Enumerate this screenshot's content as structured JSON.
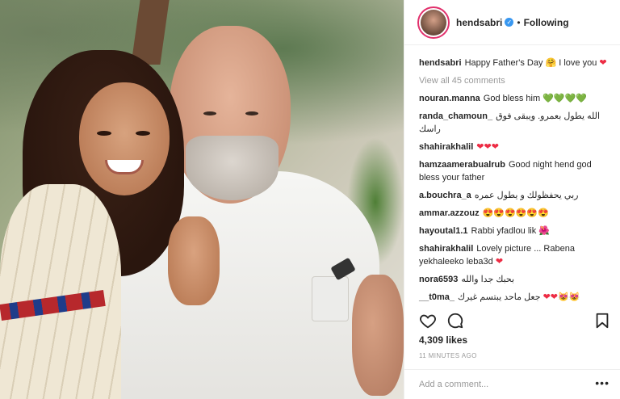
{
  "photo": {
    "description_hidden": ""
  },
  "header": {
    "username": "hendsabri",
    "separator": "•",
    "follow_status": "Following"
  },
  "caption": {
    "username": "hendsabri",
    "text": "Happy Father's Day 🤗 I love you",
    "heart": "❤"
  },
  "view_all": "View all 45 comments",
  "comments": [
    {
      "user": "nouran.manna",
      "text": "God bless him",
      "emoji": "💚💚💚💚"
    },
    {
      "user": "randa_chamoun_",
      "text": "الله يطول بعمرو. ويبقى فوق راسك",
      "emoji": ""
    },
    {
      "user": "shahirakhalil",
      "text": "",
      "emoji": "❤❤❤"
    },
    {
      "user": "hamzaamerabualrub",
      "text": "Good night hend god bless your father",
      "emoji": ""
    },
    {
      "user": "a.bouchra_a",
      "text": "ربي يحفظولك و يطول عمره",
      "emoji": ""
    },
    {
      "user": "ammar.azzouz",
      "text": "",
      "emoji": "😍😍😍😍😍😍"
    },
    {
      "user": "hayoutal1.1",
      "text": "Rabbi yfadlou lik",
      "emoji": "🌺"
    },
    {
      "user": "shahirakhalil",
      "text": "Lovely picture ... Rabena yekhaleeko leba3d",
      "emoji": "❤"
    },
    {
      "user": "nora6593",
      "text": "بحبك جدا والله",
      "emoji": ""
    },
    {
      "user": "__t0ma_",
      "text": "جعل ماحد يبتسم غيرك",
      "emoji": "❤❤😻😻"
    }
  ],
  "likes": "4,309 likes",
  "time_ago": "11 MINUTES AGO",
  "add_comment_placeholder": "Add a comment...",
  "more_label": "•••",
  "colors": {
    "verified": "#3897f0",
    "heart_red": "#ed2c44",
    "heart_green": "#2fb32a",
    "muted": "#999999",
    "text": "#262626"
  },
  "icons": {
    "like": "heart-outline-icon",
    "comment": "speech-bubble-icon",
    "save": "bookmark-icon",
    "verified": "verified-badge-icon"
  }
}
